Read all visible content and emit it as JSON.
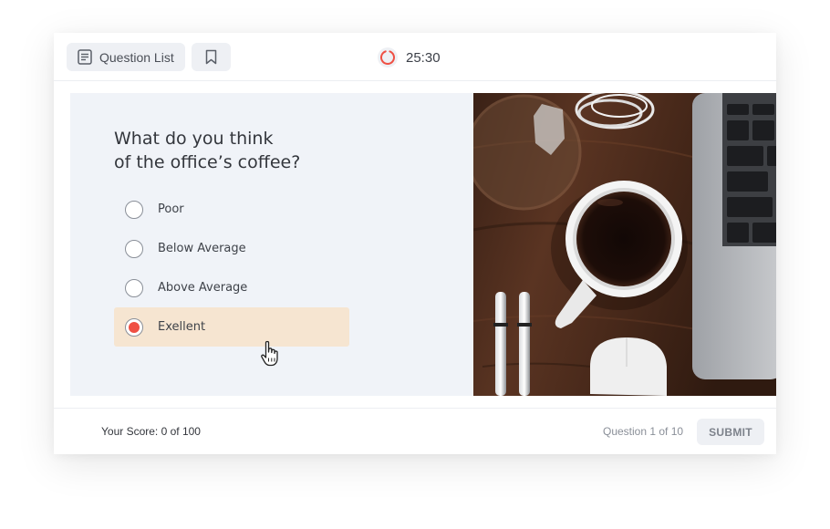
{
  "header": {
    "question_list_label": "Question List",
    "timer": "25:30"
  },
  "question": {
    "line1": "What do you think",
    "line2": "of the office’s coffee?",
    "options": [
      {
        "label": "Poor",
        "selected": false
      },
      {
        "label": "Below Average",
        "selected": false
      },
      {
        "label": "Above Average",
        "selected": false
      },
      {
        "label": "Exellent",
        "selected": true
      }
    ]
  },
  "footer": {
    "score": "Your Score: 0 of 100",
    "progress": "Question 1 of 10",
    "submit_label": "SUBMIT"
  },
  "colors": {
    "accent": "#ef5044",
    "selected_bg": "#f6e5d1",
    "panel_bg": "#f0f3f8",
    "button_bg": "#eef0f4"
  },
  "icons": {
    "question_list": "list-icon",
    "bookmark": "bookmark-icon",
    "timer": "timer-ring-icon",
    "cursor": "hand-pointer-icon"
  }
}
